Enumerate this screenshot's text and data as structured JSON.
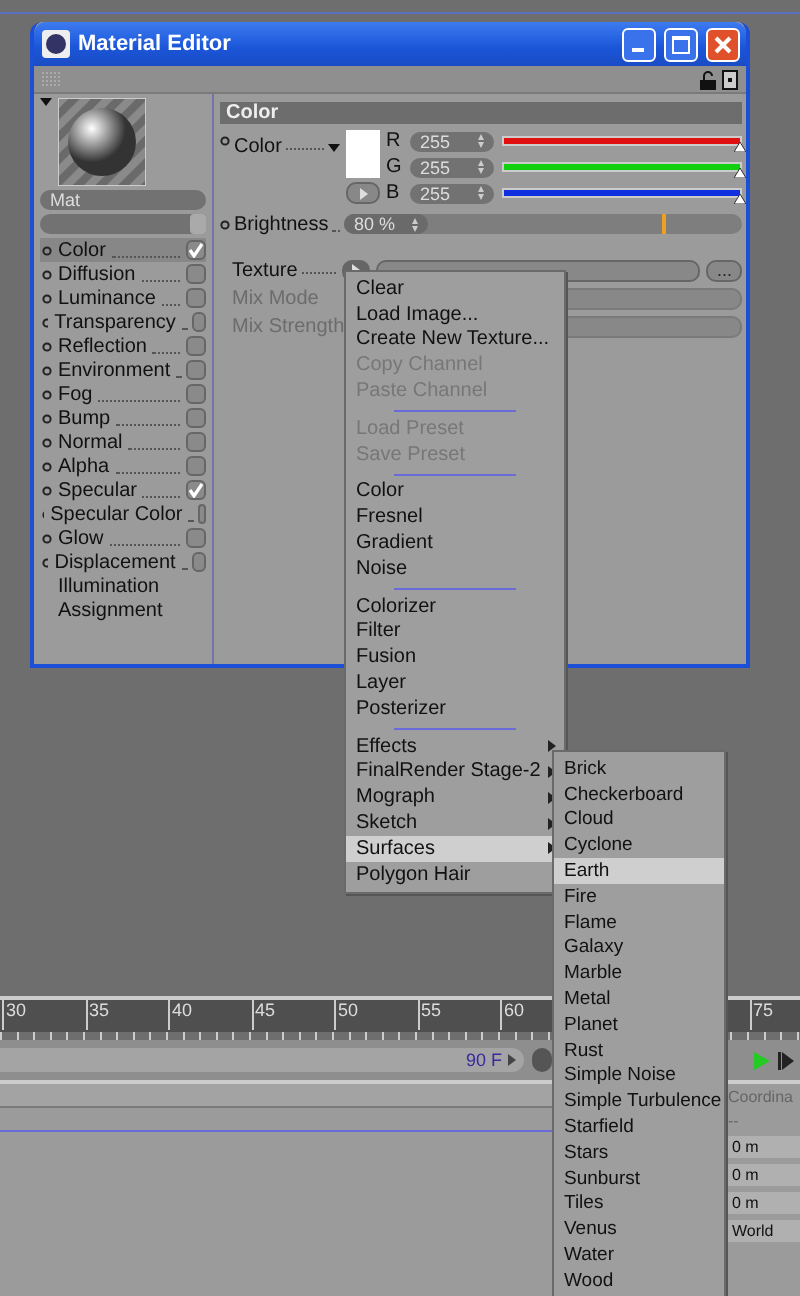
{
  "window": {
    "title": "Material Editor"
  },
  "material": {
    "name": "Mat",
    "level": 1
  },
  "channels": [
    {
      "label": "Color",
      "kind": "channel",
      "checked": true,
      "selected": true
    },
    {
      "label": "Diffusion",
      "kind": "channel",
      "checked": false,
      "selected": false
    },
    {
      "label": "Luminance",
      "kind": "channel",
      "checked": false,
      "selected": false
    },
    {
      "label": "Transparency",
      "kind": "channel",
      "checked": false,
      "selected": false
    },
    {
      "label": "Reflection",
      "kind": "channel",
      "checked": false,
      "selected": false
    },
    {
      "label": "Environment",
      "kind": "channel",
      "checked": false,
      "selected": false
    },
    {
      "label": "Fog",
      "kind": "channel",
      "checked": false,
      "selected": false
    },
    {
      "label": "Bump",
      "kind": "channel",
      "checked": false,
      "selected": false
    },
    {
      "label": "Normal",
      "kind": "channel",
      "checked": false,
      "selected": false
    },
    {
      "label": "Alpha",
      "kind": "channel",
      "checked": false,
      "selected": false
    },
    {
      "label": "Specular",
      "kind": "channel",
      "checked": true,
      "selected": false
    },
    {
      "label": "Specular Color",
      "kind": "channel",
      "checked": false,
      "selected": false
    },
    {
      "label": "Glow",
      "kind": "channel",
      "checked": false,
      "selected": false
    },
    {
      "label": "Displacement",
      "kind": "channel",
      "checked": false,
      "selected": false
    },
    {
      "label": "Illumination",
      "kind": "page",
      "selected": false
    },
    {
      "label": "Assignment",
      "kind": "page",
      "selected": false
    }
  ],
  "section": {
    "title": "Color"
  },
  "color": {
    "label": "Color",
    "components": [
      {
        "label": "R",
        "value": "255",
        "level": 1,
        "color": "#e01010"
      },
      {
        "label": "G",
        "value": "255",
        "level": 1,
        "color": "#10d010"
      },
      {
        "label": "B",
        "value": "255",
        "level": 1,
        "color": "#1030e0"
      }
    ]
  },
  "brightness": {
    "label": "Brightness",
    "value": "80 %",
    "level": 0.8
  },
  "texture": {
    "label": "Texture",
    "browse": "..."
  },
  "mix_mode": {
    "label": "Mix Mode",
    "disabled": true
  },
  "mix_strength": {
    "label": "Mix Strength",
    "disabled": true
  },
  "texture_menu": {
    "groups": [
      [
        {
          "label": "Clear",
          "disabled": false,
          "submenu": false,
          "selected": false
        },
        {
          "label": "Load Image...",
          "disabled": false,
          "submenu": false,
          "selected": false
        },
        {
          "label": "Create New Texture...",
          "disabled": false,
          "submenu": false,
          "selected": false
        },
        {
          "label": "Copy Channel",
          "disabled": true,
          "submenu": false,
          "selected": false
        },
        {
          "label": "Paste Channel",
          "disabled": true,
          "submenu": false,
          "selected": false
        }
      ],
      [
        {
          "label": "Load Preset",
          "disabled": true,
          "submenu": false,
          "selected": false
        },
        {
          "label": "Save Preset",
          "disabled": true,
          "submenu": false,
          "selected": false
        }
      ],
      [
        {
          "label": "Color",
          "disabled": false,
          "submenu": false,
          "selected": false
        },
        {
          "label": "Fresnel",
          "disabled": false,
          "submenu": false,
          "selected": false
        },
        {
          "label": "Gradient",
          "disabled": false,
          "submenu": false,
          "selected": false
        },
        {
          "label": "Noise",
          "disabled": false,
          "submenu": false,
          "selected": false
        }
      ],
      [
        {
          "label": "Colorizer",
          "disabled": false,
          "submenu": false,
          "selected": false
        },
        {
          "label": "Filter",
          "disabled": false,
          "submenu": false,
          "selected": false
        },
        {
          "label": "Fusion",
          "disabled": false,
          "submenu": false,
          "selected": false
        },
        {
          "label": "Layer",
          "disabled": false,
          "submenu": false,
          "selected": false
        },
        {
          "label": "Posterizer",
          "disabled": false,
          "submenu": false,
          "selected": false
        }
      ],
      [
        {
          "label": "Effects",
          "disabled": false,
          "submenu": true,
          "selected": false
        },
        {
          "label": "FinalRender Stage-2",
          "disabled": false,
          "submenu": true,
          "selected": false
        },
        {
          "label": "Mograph",
          "disabled": false,
          "submenu": true,
          "selected": false
        },
        {
          "label": "Sketch",
          "disabled": false,
          "submenu": true,
          "selected": false
        },
        {
          "label": "Surfaces",
          "disabled": false,
          "submenu": true,
          "selected": true
        },
        {
          "label": "Polygon Hair",
          "disabled": false,
          "submenu": false,
          "selected": false
        }
      ]
    ]
  },
  "surfaces_menu": [
    {
      "label": "Brick",
      "selected": false
    },
    {
      "label": "Checkerboard",
      "selected": false
    },
    {
      "label": "Cloud",
      "selected": false
    },
    {
      "label": "Cyclone",
      "selected": false
    },
    {
      "label": "Earth",
      "selected": true
    },
    {
      "label": "Fire",
      "selected": false
    },
    {
      "label": "Flame",
      "selected": false
    },
    {
      "label": "Galaxy",
      "selected": false
    },
    {
      "label": "Marble",
      "selected": false
    },
    {
      "label": "Metal",
      "selected": false
    },
    {
      "label": "Planet",
      "selected": false
    },
    {
      "label": "Rust",
      "selected": false
    },
    {
      "label": "Simple Noise",
      "selected": false
    },
    {
      "label": "Simple Turbulence",
      "selected": false
    },
    {
      "label": "Starfield",
      "selected": false
    },
    {
      "label": "Stars",
      "selected": false
    },
    {
      "label": "Sunburst",
      "selected": false
    },
    {
      "label": "Tiles",
      "selected": false
    },
    {
      "label": "Venus",
      "selected": false
    },
    {
      "label": "Water",
      "selected": false
    },
    {
      "label": "Wood",
      "selected": false
    }
  ],
  "timeline": {
    "ruler_labels": [
      "30",
      "35",
      "40",
      "45",
      "50",
      "55",
      "60",
      "75"
    ],
    "end_frame": "90 F",
    "level": 1
  },
  "coordinates": {
    "title": "Coordina",
    "dash": "--",
    "fields": [
      "0 m",
      "0 m",
      "0 m"
    ],
    "space": "World"
  }
}
